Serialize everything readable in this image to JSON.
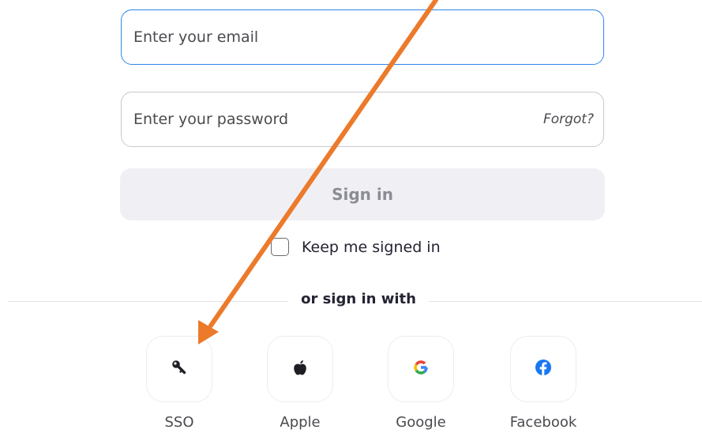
{
  "email": {
    "placeholder": "Enter your email",
    "value": ""
  },
  "password": {
    "placeholder": "Enter your password",
    "value": "",
    "forgot_label": "Forgot?"
  },
  "sign_in_button": "Sign in",
  "keep_signed_in": {
    "label": "Keep me signed in",
    "checked": false
  },
  "divider_text": "or sign in with",
  "providers": [
    {
      "label": "SSO",
      "icon": "key-icon"
    },
    {
      "label": "Apple",
      "icon": "apple-icon"
    },
    {
      "label": "Google",
      "icon": "google-icon"
    },
    {
      "label": "Facebook",
      "icon": "facebook-icon"
    }
  ],
  "colors": {
    "email_focus_border": "#2f86e8",
    "sign_in_bg": "#f0f0f4",
    "sign_in_text": "#8c8c95",
    "annotation_arrow": "#ec7a2b",
    "facebook_blue": "#1877f2"
  }
}
